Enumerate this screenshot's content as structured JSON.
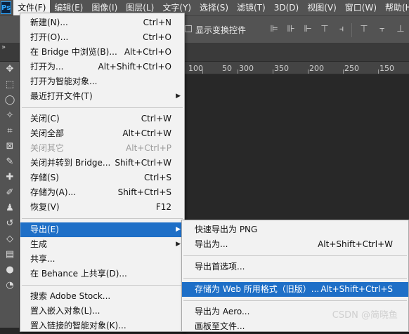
{
  "app": {
    "logo": "Ps"
  },
  "menubar": [
    "文件(F)",
    "编辑(E)",
    "图像(I)",
    "图层(L)",
    "文字(Y)",
    "选择(S)",
    "滤镜(T)",
    "3D(D)",
    "视图(V)",
    "窗口(W)",
    "帮助(H)"
  ],
  "options": {
    "show_transform": "显示变换控件"
  },
  "ruler": [
    "100",
    "50",
    "300",
    "350",
    "200",
    "250",
    "150"
  ],
  "file_menu": [
    {
      "label": "新建(N)...",
      "shortcut": "Ctrl+N"
    },
    {
      "label": "打开(O)...",
      "shortcut": "Ctrl+O"
    },
    {
      "label": "在 Bridge 中浏览(B)...",
      "shortcut": "Alt+Ctrl+O"
    },
    {
      "label": "打开为...",
      "shortcut": "Alt+Shift+Ctrl+O"
    },
    {
      "label": "打开为智能对象...",
      "shortcut": ""
    },
    {
      "label": "最近打开文件(T)",
      "shortcut": ""
    },
    {
      "label": "关闭(C)",
      "shortcut": "Ctrl+W"
    },
    {
      "label": "关闭全部",
      "shortcut": "Alt+Ctrl+W"
    },
    {
      "label": "关闭其它",
      "shortcut": "Alt+Ctrl+P"
    },
    {
      "label": "关闭并转到 Bridge...",
      "shortcut": "Shift+Ctrl+W"
    },
    {
      "label": "存储(S)",
      "shortcut": "Ctrl+S"
    },
    {
      "label": "存储为(A)...",
      "shortcut": "Shift+Ctrl+S"
    },
    {
      "label": "恢复(V)",
      "shortcut": "F12"
    },
    {
      "label": "导出(E)",
      "shortcut": ""
    },
    {
      "label": "生成",
      "shortcut": ""
    },
    {
      "label": "共享...",
      "shortcut": ""
    },
    {
      "label": "在 Behance 上共享(D)...",
      "shortcut": ""
    },
    {
      "label": "搜索 Adobe Stock...",
      "shortcut": ""
    },
    {
      "label": "置入嵌入对象(L)...",
      "shortcut": ""
    },
    {
      "label": "置入链接的智能对象(K)...",
      "shortcut": ""
    }
  ],
  "export_menu": [
    {
      "label": "快速导出为 PNG",
      "shortcut": ""
    },
    {
      "label": "导出为...",
      "shortcut": "Alt+Shift+Ctrl+W"
    },
    {
      "label": "导出首选项...",
      "shortcut": ""
    },
    {
      "label": "存储为 Web 所用格式（旧版）...",
      "shortcut": "Alt+Shift+Ctrl+S"
    },
    {
      "label": "导出为 Aero...",
      "shortcut": ""
    },
    {
      "label": "画板至文件...",
      "shortcut": ""
    }
  ],
  "watermark": "CSDN @简晓鱼"
}
